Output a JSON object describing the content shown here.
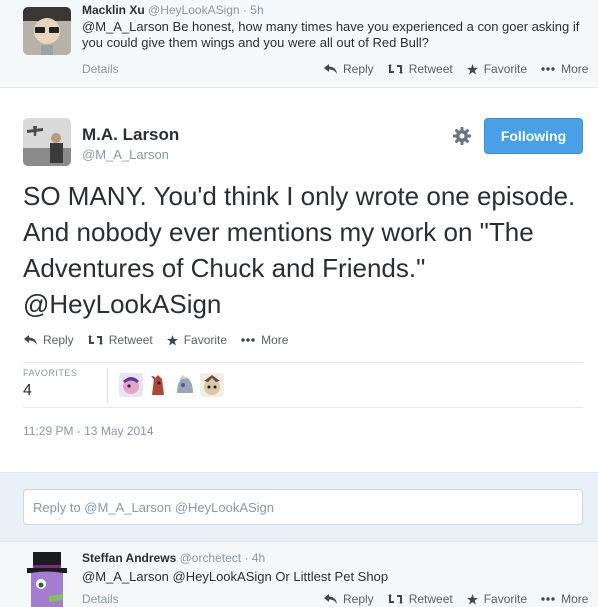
{
  "top_tweet": {
    "author_name": "Macklin Xu",
    "handle": "@HeyLookASign",
    "time": "5h",
    "text": "@M_A_Larson Be honest, how many times have you experienced a con goer asking if you could give them wings and you were all out of Red Bull?",
    "details": "Details"
  },
  "actions": {
    "reply": "Reply",
    "retweet": "Retweet",
    "favorite": "Favorite",
    "more": "More"
  },
  "main_tweet": {
    "author_name": "M.A. Larson",
    "handle": "@M_A_Larson",
    "follow_label": "Following",
    "text": "SO MANY. You'd think I only wrote one episode. And nobody ever mentions my work on \"The Adventures of Chuck and Friends.\" @HeyLookASign",
    "favorites_label": "FAVORITES",
    "favorites_count": "4",
    "timestamp": "11:29 PM - 13 May 2014"
  },
  "reply_box": {
    "placeholder": "Reply to @M_A_Larson @HeyLookASign"
  },
  "bottom_tweet": {
    "author_name": "Steffan Andrews",
    "handle": "@orchetect",
    "time": "4h",
    "text": "@M_A_Larson @HeyLookASign Or Littlest Pet Shop",
    "details": "Details"
  },
  "colors": {
    "accent": "#4aa0e6",
    "muted": "#8899a6",
    "text": "#292f33",
    "reply_area_bg": "#e8f1f8"
  }
}
